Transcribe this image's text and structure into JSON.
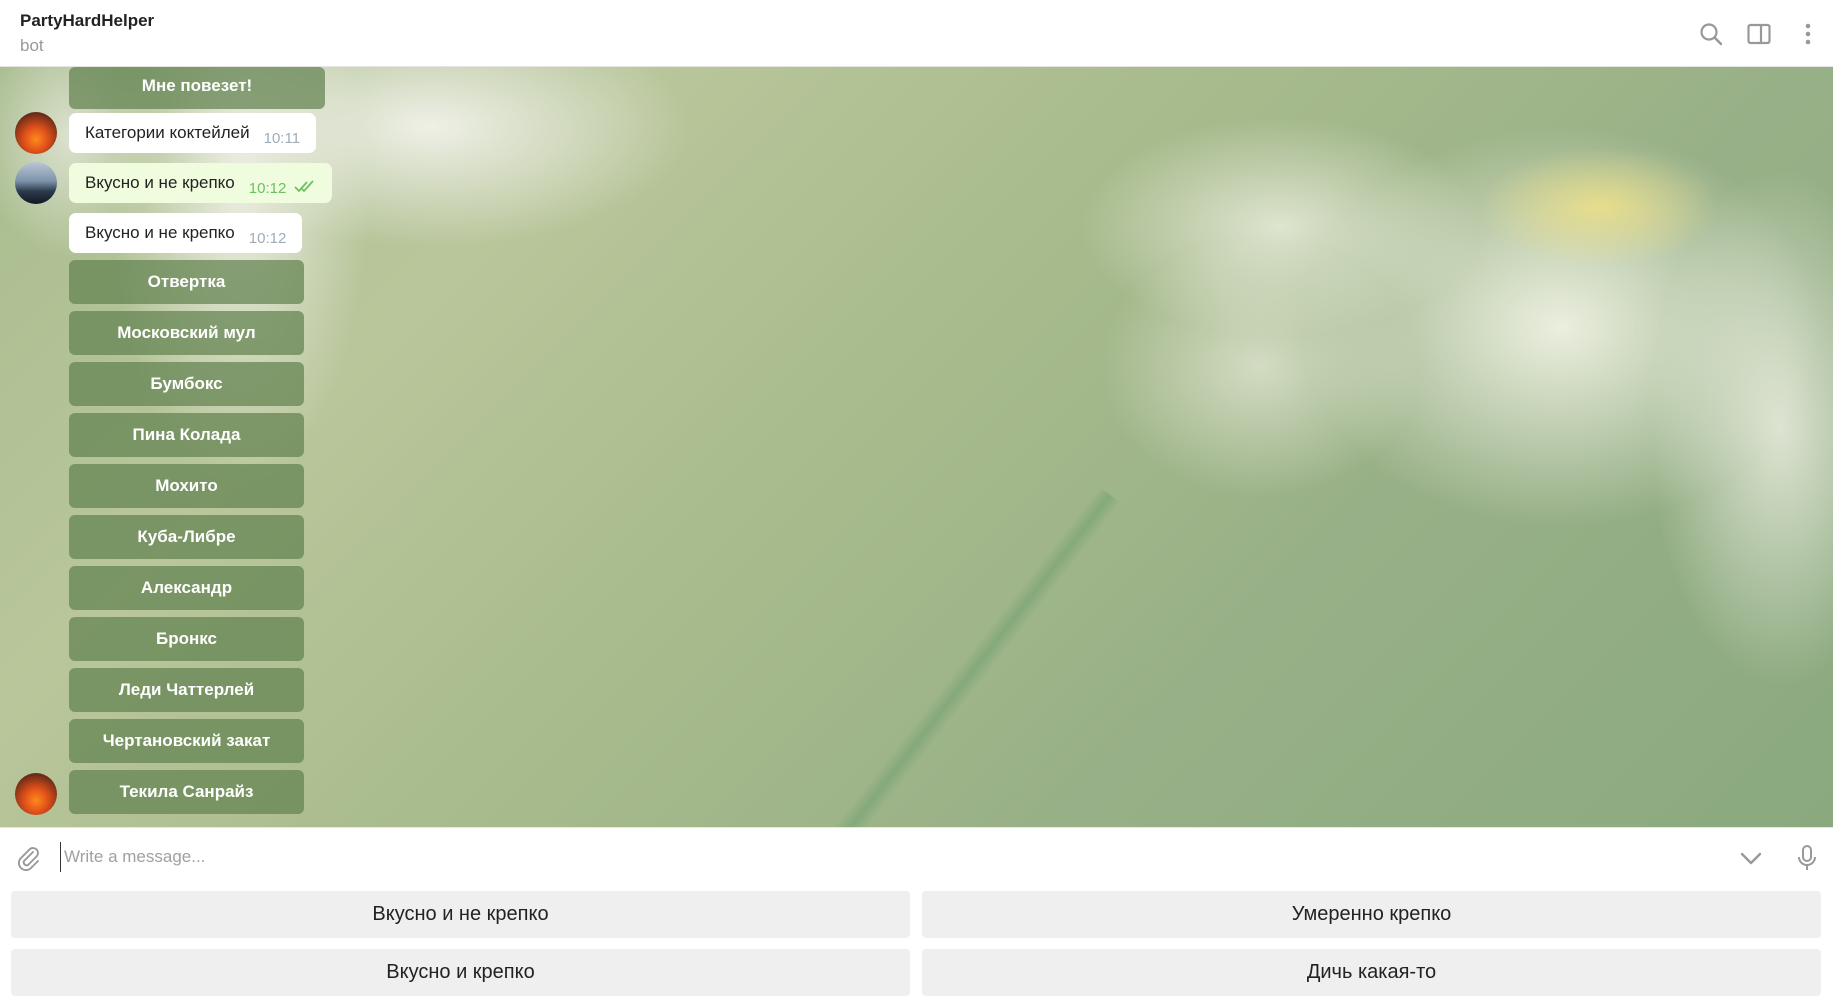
{
  "header": {
    "title": "PartyHardHelper",
    "subtitle": "bot",
    "icons": [
      "search-icon",
      "sidebar-toggle-icon",
      "more-vertical-icon"
    ]
  },
  "messages": {
    "top_button": "Мне повезет!",
    "bot_msg_1": {
      "text": "Категории коктейлей",
      "time": "10:11"
    },
    "user_msg": {
      "text": "Вкусно и не крепко",
      "time": "10:12"
    },
    "bot_msg_2": {
      "text": "Вкусно и не крепко",
      "time": "10:12"
    },
    "inline_buttons": [
      "Отвертка",
      "Московский мул",
      "Бумбокс",
      "Пина Колада",
      "Мохито",
      "Куба-Либре",
      "Александр",
      "Бронкс",
      "Леди Чаттерлей",
      "Чертановский закат",
      "Текила Санрайз"
    ]
  },
  "composer": {
    "placeholder": "Write a message...",
    "icons": [
      "paperclip-icon",
      "chevron-down-icon",
      "microphone-icon"
    ]
  },
  "reply_keyboard": {
    "buttons": [
      "Вкусно и не крепко",
      "Умеренно крепко",
      "Вкусно и крепко",
      "Дичь какая-то"
    ]
  },
  "colors": {
    "inline_button_bg": "#628250",
    "outgoing_bubble": "#effdde",
    "read_check": "#6dbf62"
  }
}
